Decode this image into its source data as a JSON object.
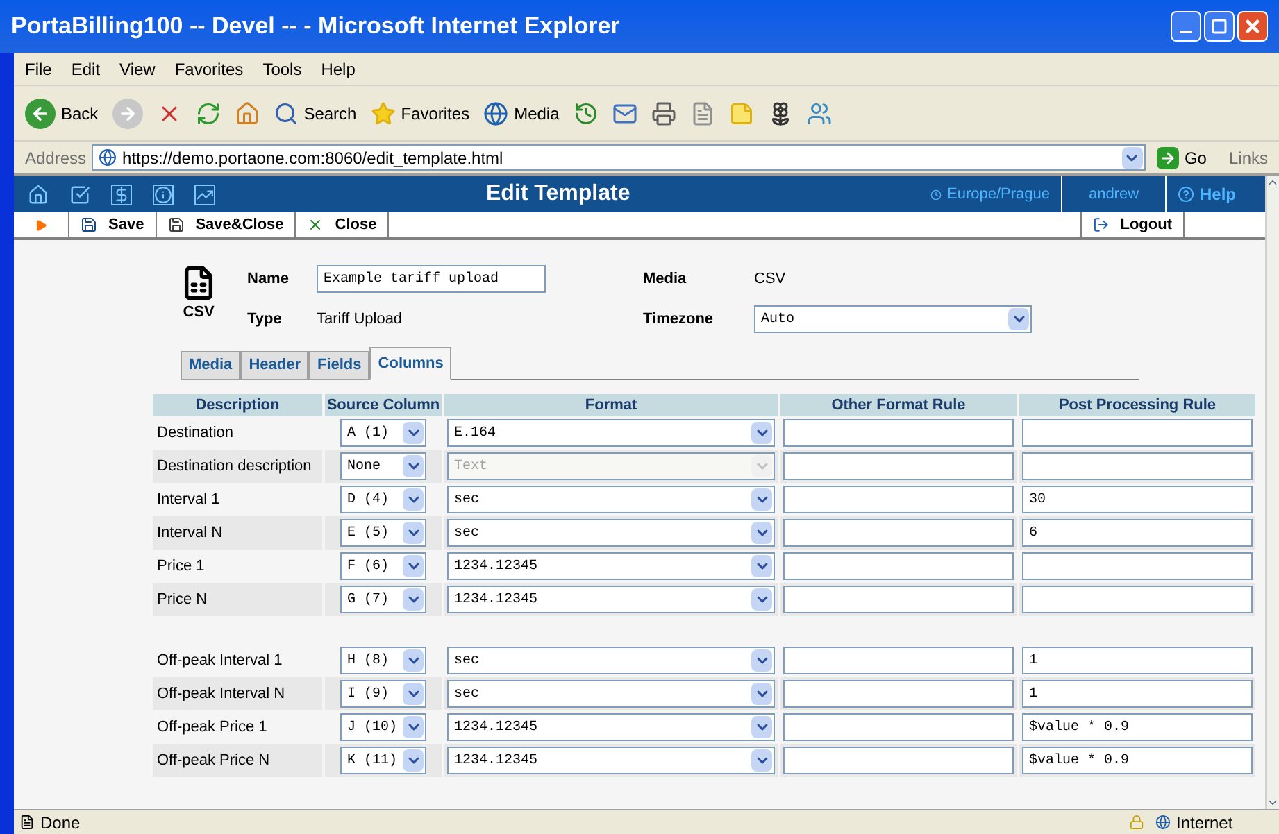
{
  "window": {
    "title": "PortaBilling100 -- Devel -- - Microsoft Internet Explorer"
  },
  "menu": [
    "File",
    "Edit",
    "View",
    "Favorites",
    "Tools",
    "Help"
  ],
  "toolbar": {
    "back": "Back",
    "search": "Search",
    "favorites": "Favorites",
    "media": "Media"
  },
  "address": {
    "label": "Address",
    "url": "https://demo.portaone.com:8060/edit_template.html",
    "go": "Go",
    "links": "Links"
  },
  "app_header": {
    "title": "Edit Template",
    "timezone": "Europe/Prague",
    "user": "andrew",
    "help": "Help"
  },
  "actions": {
    "save": "Save",
    "save_close": "Save&Close",
    "close": "Close",
    "logout": "Logout"
  },
  "form": {
    "icon_label": "CSV",
    "name_label": "Name",
    "name_value": "Example tariff upload",
    "type_label": "Type",
    "type_value": "Tariff Upload",
    "media_label": "Media",
    "media_value": "CSV",
    "timezone_label": "Timezone",
    "timezone_value": "Auto"
  },
  "tabs": [
    {
      "label": "Media",
      "selected": false
    },
    {
      "label": "Header",
      "selected": false
    },
    {
      "label": "Fields",
      "selected": false
    },
    {
      "label": "Columns",
      "selected": true
    }
  ],
  "table": {
    "columns": [
      "Description",
      "Source Column",
      "Format",
      "Other Format Rule",
      "Post Processing Rule"
    ],
    "groups": [
      [
        {
          "description": "Destination",
          "source": "A (1)",
          "format": "E.164",
          "format_disabled": false
        },
        {
          "description": "Destination description",
          "source": "None",
          "format": "Text",
          "format_disabled": true
        },
        {
          "description": "Interval 1",
          "source": "D (4)",
          "format": "sec",
          "format_disabled": false,
          "post": "30"
        },
        {
          "description": "Interval N",
          "source": "E (5)",
          "format": "sec",
          "format_disabled": false,
          "post": "6"
        },
        {
          "description": "Price 1",
          "source": "F (6)",
          "format": "1234.12345",
          "format_disabled": false
        },
        {
          "description": "Price N",
          "source": "G (7)",
          "format": "1234.12345",
          "format_disabled": false
        }
      ],
      [
        {
          "description": "Off-peak Interval 1",
          "source": "H (8)",
          "format": "sec",
          "format_disabled": false,
          "post": "1"
        },
        {
          "description": "Off-peak Interval N",
          "source": "I (9)",
          "format": "sec",
          "format_disabled": false,
          "post": "1"
        },
        {
          "description": "Off-peak Price 1",
          "source": "J (10)",
          "format": "1234.12345",
          "format_disabled": false,
          "post": "$value * 0.9"
        },
        {
          "description": "Off-peak Price N",
          "source": "K (11)",
          "format": "1234.12345",
          "format_disabled": false,
          "post": "$value * 0.9"
        }
      ]
    ]
  },
  "status_bar": {
    "text": "Done",
    "zone": "Internet"
  }
}
